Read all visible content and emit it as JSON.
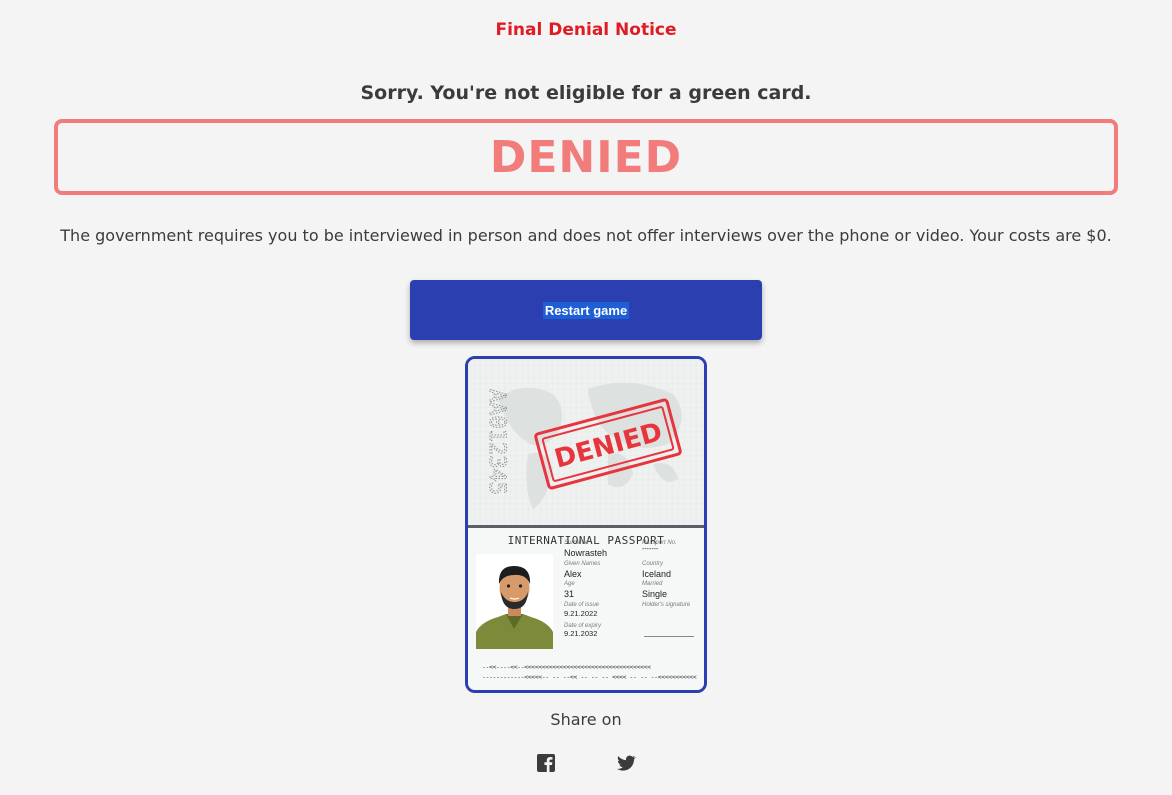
{
  "notice_title": "Final Denial Notice",
  "result": {
    "headline": "Sorry. You're not eligible for a green card.",
    "status": "DENIED",
    "explanation": "The government requires you to be interviewed in person and does not offer interviews over the phone or video. Your costs are $0."
  },
  "restart_label": "Restart game",
  "passport": {
    "number": "AA012345",
    "stamp": "DENIED",
    "heading": "INTERNATIONAL PASSPORT",
    "labels": {
      "surname": "Surname",
      "given_names": "Given Names",
      "age": "Age",
      "date_of_issue": "Date of issue",
      "date_of_expiry": "Date of expiry",
      "passport_no": "Passport No.",
      "country": "Country",
      "married": "Married",
      "signature": "Holder's signature"
    },
    "values": {
      "surname": "Nowrasteh",
      "given_names": "Alex",
      "age": "31",
      "date_of_issue": "9.21.2022",
      "date_of_expiry": "9.21.2032",
      "passport_no": "-------",
      "country": "Iceland",
      "married": "Single"
    },
    "mrz_line1": "--<<----<<--<<<<<<<<<<<<<<<<<<<<<<<<<<<<<<<<<<<<",
    "mrz_line2": "------------<<<<<-- -- --<< -- -- -- <<<< -- -- --<<<<<<<<<<<"
  },
  "share": {
    "label": "Share on",
    "icons": [
      "facebook-icon",
      "twitter-icon"
    ]
  },
  "colors": {
    "accent_red": "#e01b23",
    "denied_pink": "#f27c7c",
    "button_blue": "#2c3fb0",
    "background": "#f3f4f3"
  }
}
